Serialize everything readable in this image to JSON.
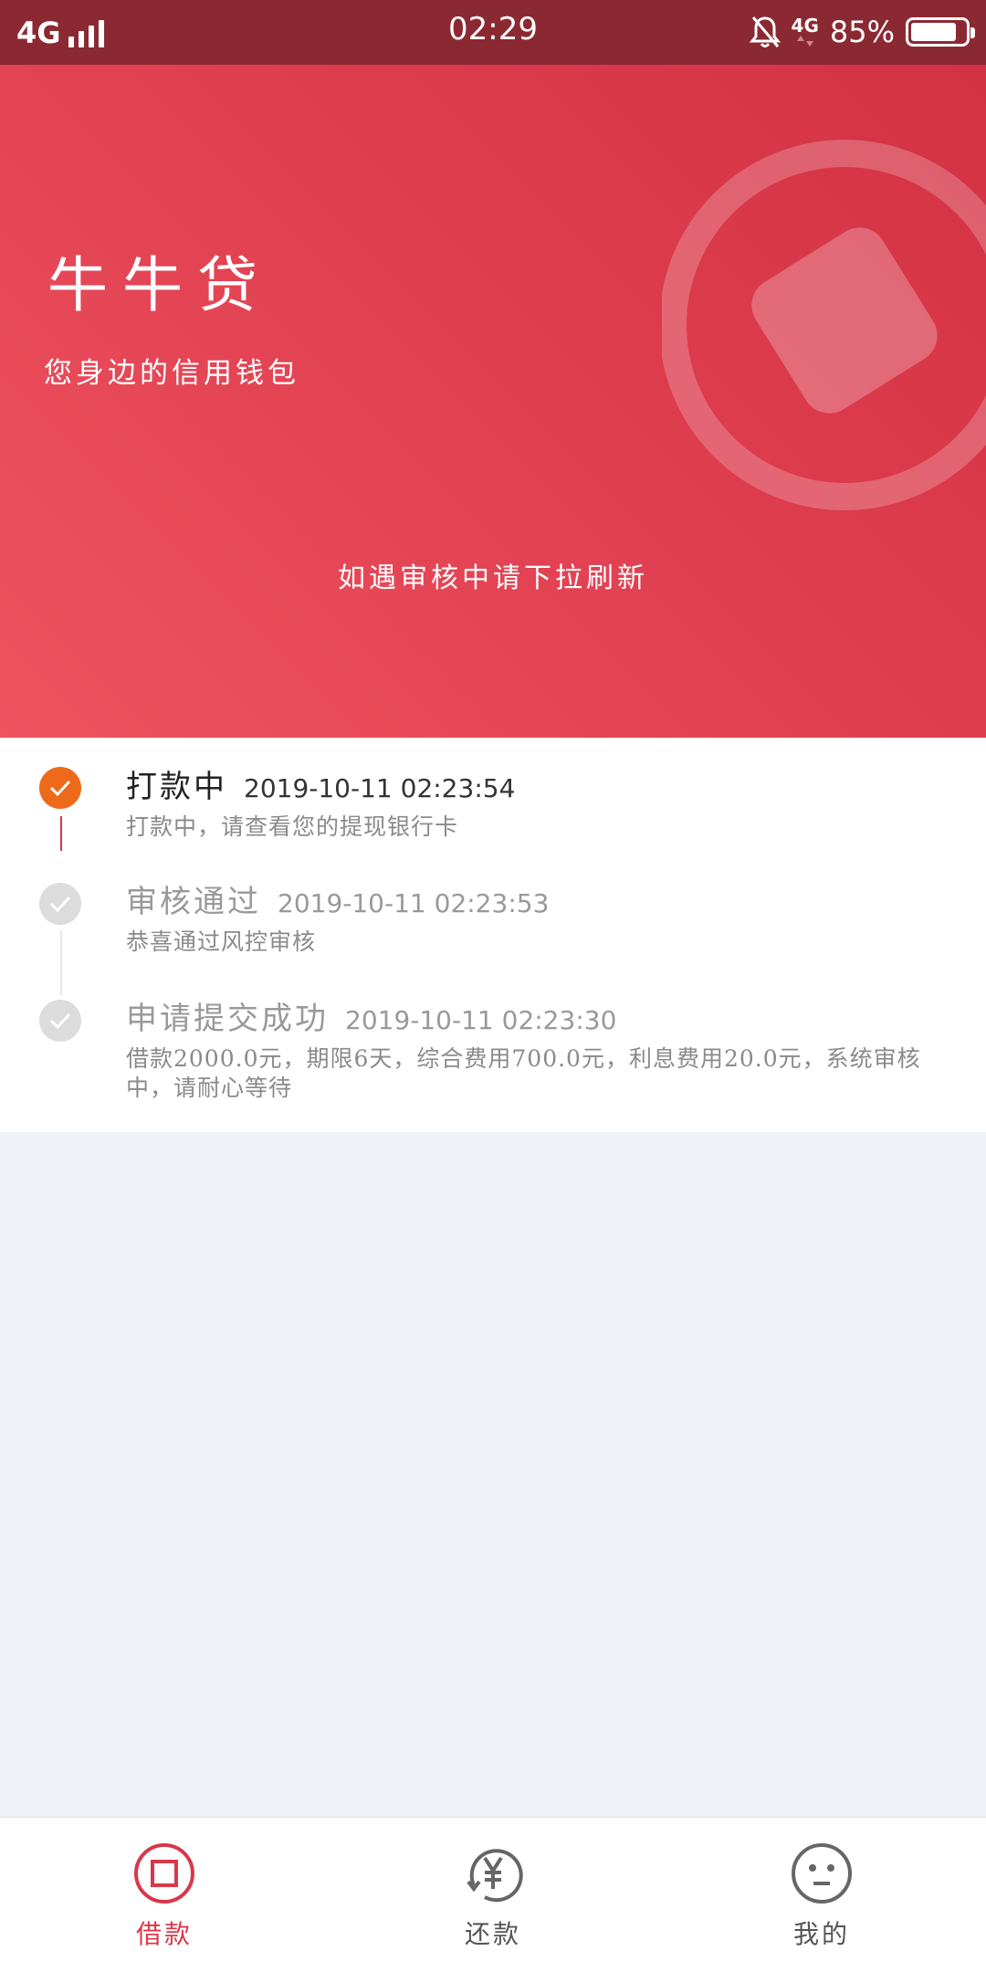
{
  "status_bar": {
    "network": "4G",
    "time": "02:29",
    "secondary_network": "4G",
    "battery": "85%",
    "battery_level": 0.85
  },
  "hero": {
    "title": "牛牛贷",
    "subtitle": "您身边的信用钱包",
    "hint": "如遇审核中请下拉刷新"
  },
  "timeline": [
    {
      "title": "打款中",
      "time": "2019-10-11 02:23:54",
      "desc": "打款中，请查看您的提现银行卡",
      "state": "active"
    },
    {
      "title": "审核通过",
      "time": "2019-10-11 02:23:53",
      "desc": "恭喜通过风控审核",
      "state": "done"
    },
    {
      "title": "申请提交成功",
      "time": "2019-10-11 02:23:30",
      "desc": "借款2000.0元，期限6天，综合费用700.0元，利息费用20.0元，系统审核中，请耐心等待",
      "state": "done"
    }
  ],
  "tabbar": {
    "tabs": [
      {
        "label": "借款",
        "icon": "loan-icon",
        "active": true
      },
      {
        "label": "还款",
        "icon": "yen-refresh-icon",
        "active": false
      },
      {
        "label": "我的",
        "icon": "face-icon",
        "active": false
      }
    ]
  },
  "colors": {
    "status_bar": "#8b2932",
    "hero_start": "#ee5360",
    "hero_end": "#d23244",
    "active_step": "#ec6a1a",
    "active_line": "#d9374a",
    "active_tab": "#d9374a",
    "inactive_tab": "#555555",
    "page_bg": "#eef1f5"
  }
}
